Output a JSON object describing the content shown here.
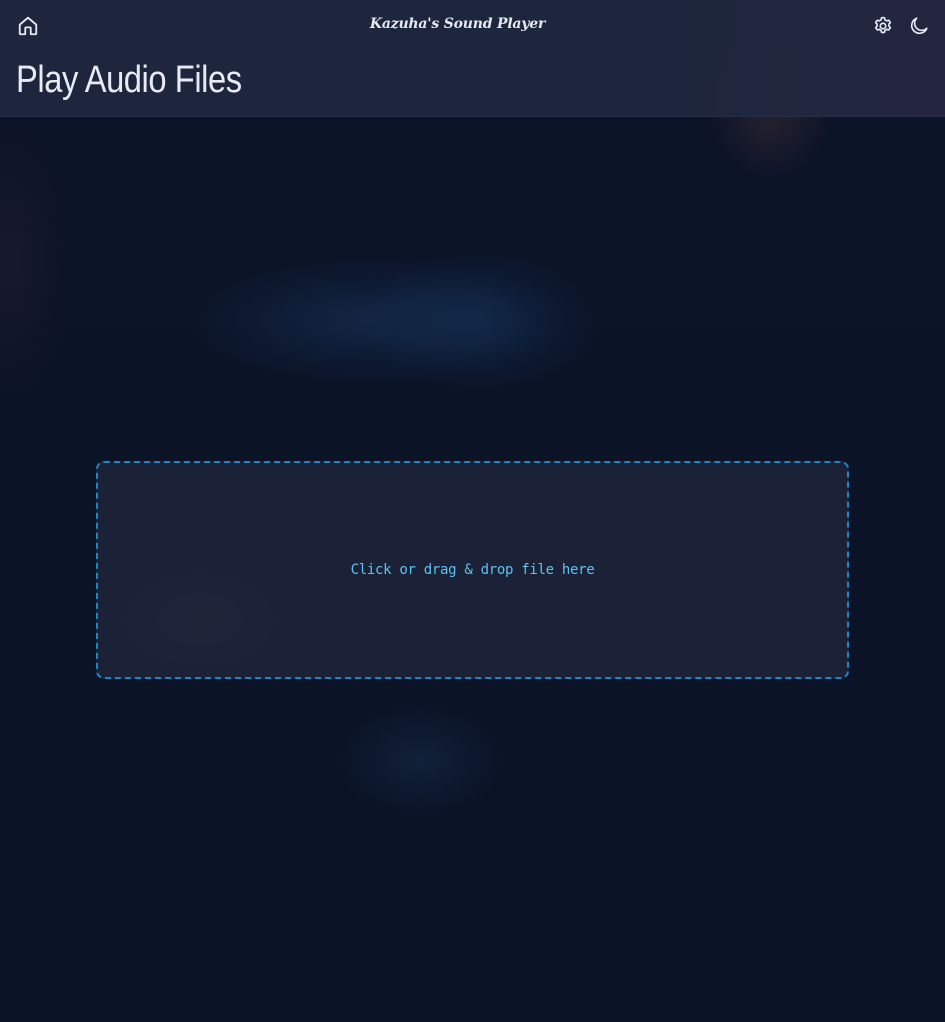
{
  "header": {
    "app_title": "Kazuha's Sound Player",
    "page_title": "Play Audio Files",
    "icons": {
      "home": "home-icon",
      "settings": "gear-icon",
      "theme": "moon-icon"
    }
  },
  "dropzone": {
    "label": "Click or drag & drop file here"
  },
  "colors": {
    "background": "#0b1226",
    "header": "#1e263c",
    "accent_border": "#1f86c4",
    "accent_text": "#5fc1f2",
    "title_text": "#e8ebf3"
  }
}
